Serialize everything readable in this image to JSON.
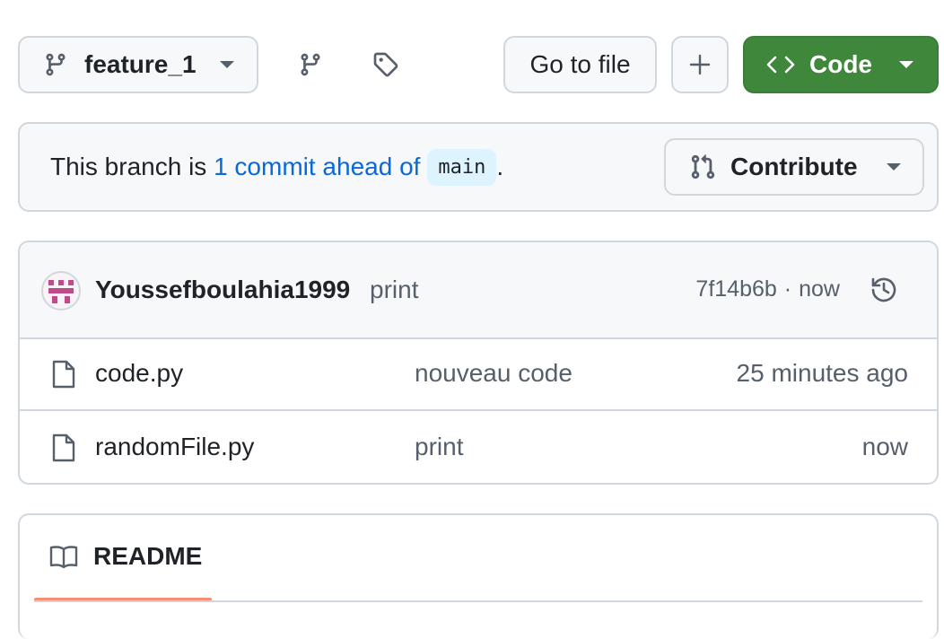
{
  "toolbar": {
    "branch_name": "feature_1",
    "go_to_file_label": "Go to file",
    "add_label": "+",
    "code_label": "Code"
  },
  "branch_banner": {
    "text_prefix": "This branch is ",
    "ahead_link": "1 commit ahead of",
    "base_branch": "main",
    "text_suffix": ".",
    "contribute_label": "Contribute"
  },
  "latest_commit": {
    "author": "Youssefboulahia1999",
    "message": "print",
    "sha": "7f14b6b",
    "separator": "·",
    "time": "now"
  },
  "files": [
    {
      "name": "code.py",
      "commit_message": "nouveau code",
      "time": "25 minutes ago"
    },
    {
      "name": "randomFile.py",
      "commit_message": "print",
      "time": "now"
    }
  ],
  "readme": {
    "tab_label": "README"
  },
  "colors": {
    "primary_green": "#3f873b",
    "link_blue": "#0969da",
    "readme_tab_underline": "#fd8c73"
  }
}
